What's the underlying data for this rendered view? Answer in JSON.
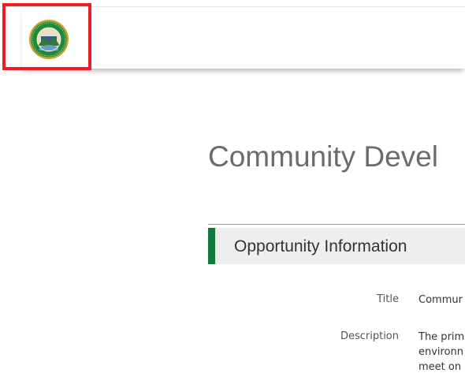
{
  "page": {
    "title": "Community Devel"
  },
  "section": {
    "title": "Opportunity Information"
  },
  "fields": {
    "title_label": "Title",
    "title_value": "Commur",
    "description_label": "Description",
    "description_lines": [
      "The prim",
      "environn",
      "meet on"
    ]
  },
  "colors": {
    "accent": "#0e7a3c",
    "highlight": "#ee1c24"
  },
  "icons": {
    "logo": "seal-logo"
  }
}
